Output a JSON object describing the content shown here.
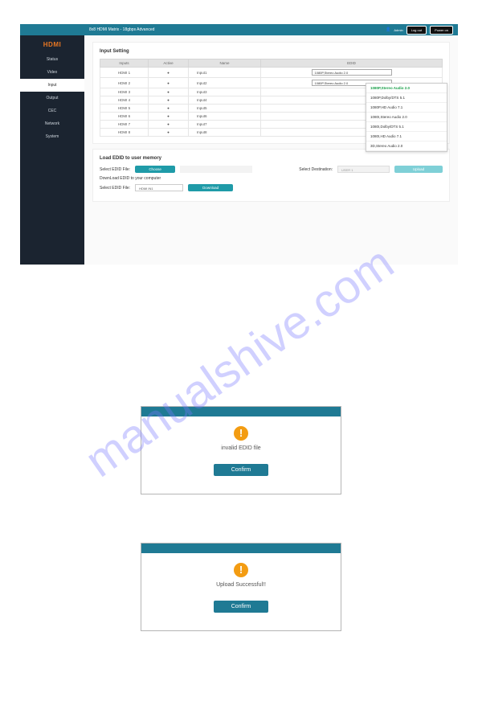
{
  "header": {
    "logo": "HDMI",
    "title": "8x8 HDMI Matrix - 18gbps Advanced",
    "admin_label": "Admin",
    "logout_label": "Log out",
    "power_label": "Power on"
  },
  "sidebar": {
    "items": [
      {
        "label": "Status"
      },
      {
        "label": "Video"
      },
      {
        "label": "Input"
      },
      {
        "label": "Output"
      },
      {
        "label": "CEC"
      },
      {
        "label": "Network"
      },
      {
        "label": "System"
      }
    ]
  },
  "input_setting": {
    "title": "Input Setting",
    "columns": [
      "Inputs",
      "Active",
      "Name",
      "EDID"
    ],
    "rows": [
      {
        "input": "HDMI 1",
        "active": "●",
        "name": "Input1",
        "edid": "1080P,Stereo Audio 2.0"
      },
      {
        "input": "HDMI 2",
        "active": "●",
        "name": "Input2",
        "edid": "1080P,Stereo Audio 2.0"
      },
      {
        "input": "HDMI 3",
        "active": "●",
        "name": "Input3",
        "edid": ""
      },
      {
        "input": "HDMI 4",
        "active": "●",
        "name": "Input4",
        "edid": ""
      },
      {
        "input": "HDMI 5",
        "active": "●",
        "name": "Input5",
        "edid": ""
      },
      {
        "input": "HDMI 6",
        "active": "●",
        "name": "Input6",
        "edid": ""
      },
      {
        "input": "HDMI 7",
        "active": "●",
        "name": "Input7",
        "edid": ""
      },
      {
        "input": "HDMI 8",
        "active": "●",
        "name": "Input8",
        "edid": ""
      }
    ]
  },
  "dropdown": {
    "items": [
      "1080P,Stereo Audio 2.0",
      "1080P,Dolby/DTS 5.1",
      "1080P,HD Audio 7.1",
      "1080I,Stereo Audio 2.0",
      "1080I,Dolby/DTS 5.1",
      "1080I,HD Audio 7.1",
      "3D,Stereo Audio 2.0"
    ]
  },
  "load_edid": {
    "title": "Load EDID to user memory",
    "select_file_label": "Select EDID File:",
    "choose_btn": "Choose",
    "dest_label": "Select Destination:",
    "dest_value": "USER 1",
    "upload_btn": "Upload"
  },
  "download_edid": {
    "title": "DownLoad EDID to your computer",
    "select_file_label": "Select EDID File:",
    "file_value": "HDMI IN1",
    "download_btn": "Download"
  },
  "dialog1": {
    "msg": "invalid EDID file",
    "confirm": "Confirm"
  },
  "dialog2": {
    "msg": "Upload Successful!!",
    "confirm": "Confirm"
  },
  "watermark": "manualshive.com"
}
